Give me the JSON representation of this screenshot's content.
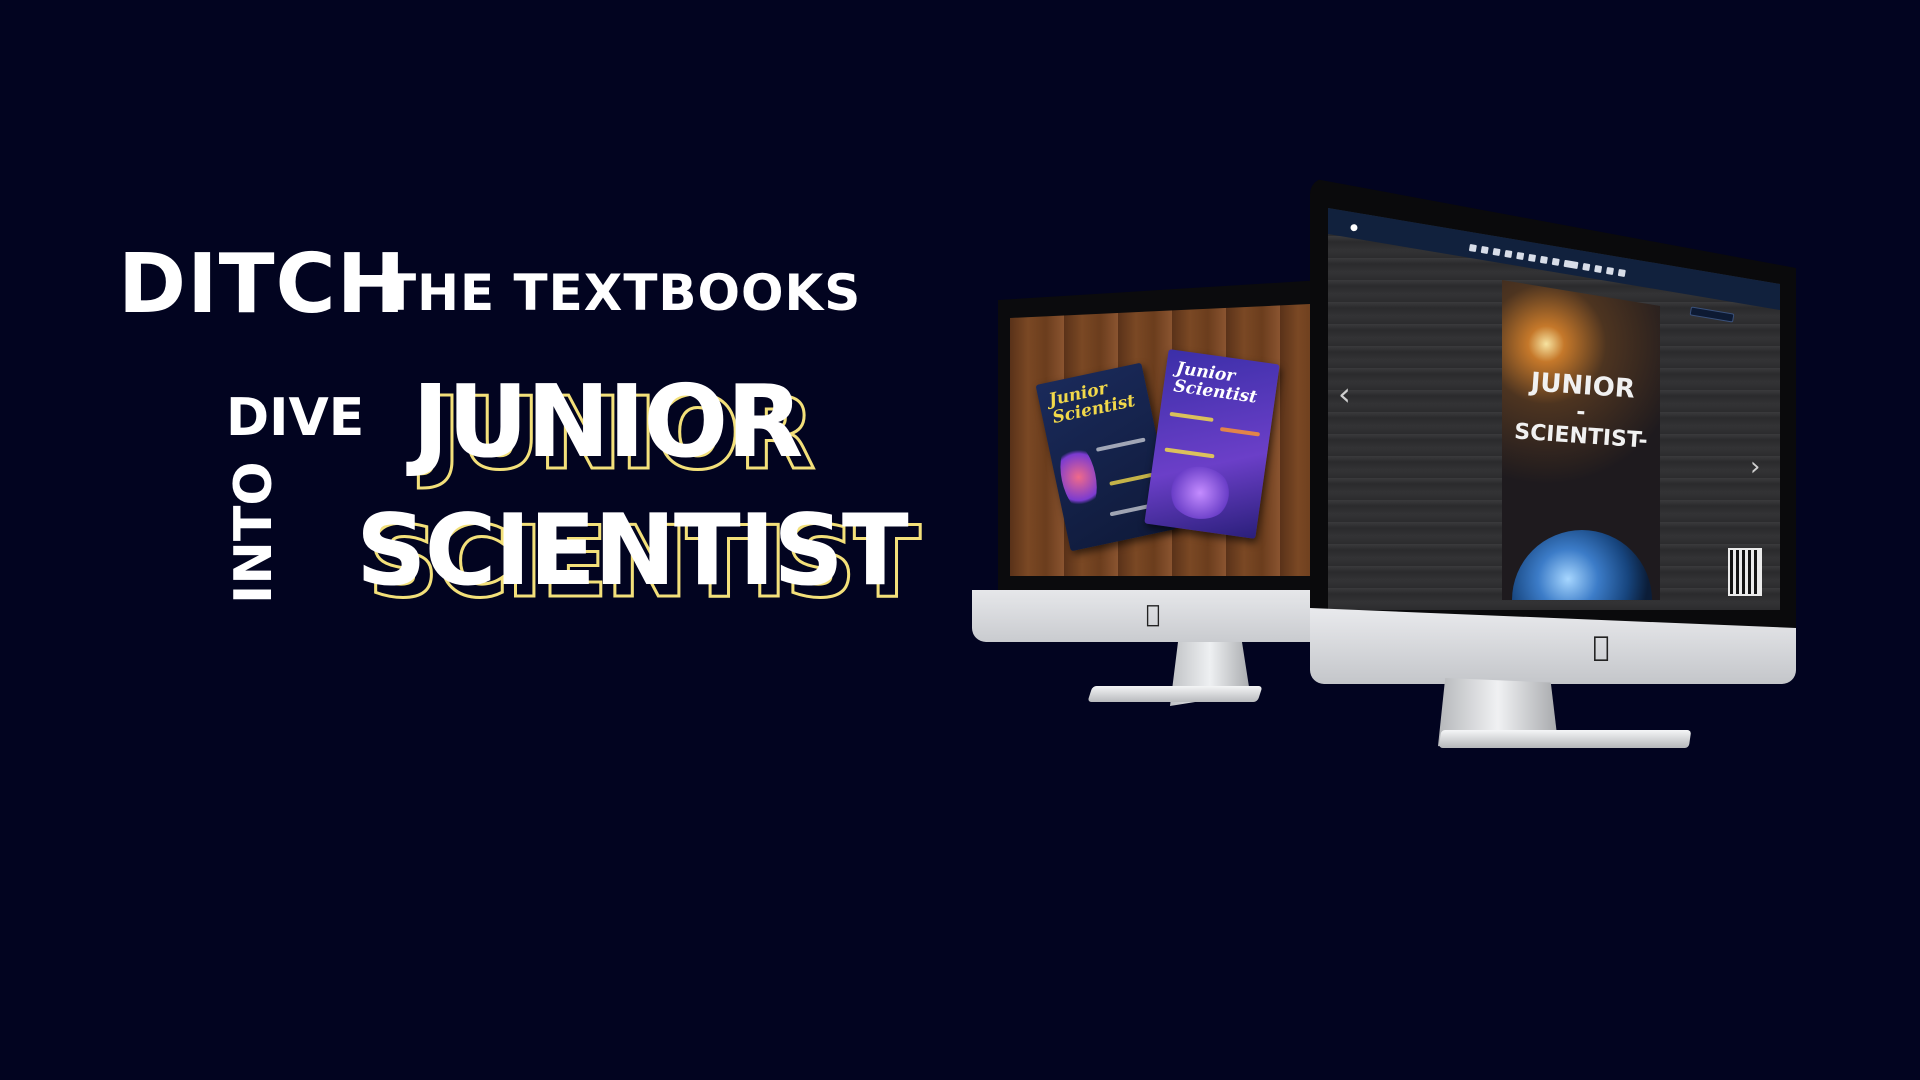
{
  "headline": {
    "ditch": "DITCH",
    "the_textbooks": "THE TEXTBOOKS",
    "dive": "DIVE",
    "into": "INTO",
    "junior": "JUNIOR",
    "scientist": "SCIENTIST"
  },
  "back_monitor": {
    "magazine_1_title": "Junior Scientist",
    "magazine_2_title": "Junior Scientist"
  },
  "front_monitor": {
    "cover_line_1": "JUNIOR",
    "cover_line_2": "-SCIENTIST-",
    "nav_prev": "‹",
    "nav_next": "›"
  },
  "colors": {
    "background": "#020420",
    "headline_text": "#ffffff",
    "outline_shadow": "#f3e07a",
    "toolbar": "#11213d"
  },
  "icons": [
    "apple-logo-icon",
    "chevron-left-icon",
    "chevron-right-icon",
    "qr-code-icon"
  ]
}
